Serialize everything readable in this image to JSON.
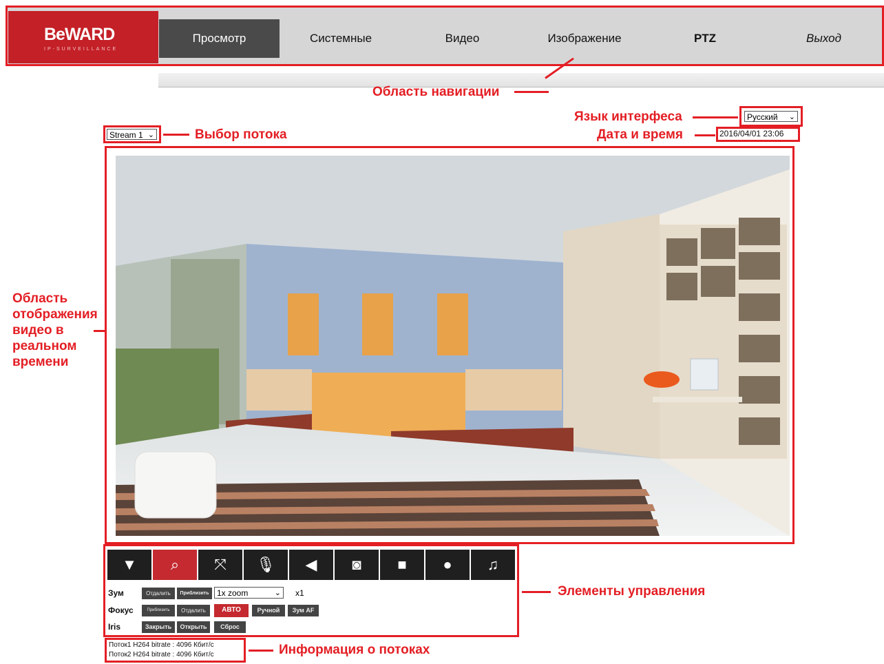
{
  "logo": {
    "brand": "BeWARD",
    "sub": "IP-SURVEILLANCE"
  },
  "nav": {
    "tabs": [
      {
        "label": "Просмотр"
      },
      {
        "label": "Системные"
      },
      {
        "label": "Видео"
      },
      {
        "label": "Изображение"
      },
      {
        "label": "PTZ"
      },
      {
        "label": "Выход"
      }
    ]
  },
  "annotations": {
    "nav_area": "Область навигации",
    "language": "Язык интерфеса",
    "datetime": "Дата и время",
    "stream_select": "Выбор потока",
    "video_area": [
      "Область",
      "отображения",
      "видео в",
      "реальном",
      "времени"
    ],
    "controls": "Элементы управления",
    "stream_info": "Информация о потоках"
  },
  "language_select": {
    "value": "Русский"
  },
  "datetime": "2016/04/01 23:06",
  "stream_select": {
    "value": "Stream 1"
  },
  "toolbar": {
    "icons": [
      "triangle-down-icon",
      "zoom-search-icon",
      "fullscreen-icon",
      "microphone-icon",
      "speaker-icon",
      "camera-snapshot-icon",
      "stop-icon",
      "record-icon",
      "alarm-bell-icon"
    ]
  },
  "controls": {
    "zoom": {
      "label": "Зум",
      "out": "Отдалить",
      "in": "Приблизить",
      "select": "1x zoom",
      "factor": "x1"
    },
    "focus": {
      "label": "Фокус",
      "near": "Приблизить",
      "far": "Отдалить",
      "auto": "АВТО",
      "manual": "Ручной",
      "af": "Зум AF"
    },
    "iris": {
      "label": "Iris",
      "close": "Закрыть",
      "open": "Открыть",
      "reset": "Сброс"
    }
  },
  "stream_info": [
    "Поток1 H264 bitrate : 4096 Кбит/с",
    "Поток2 H264 bitrate : 4096 Кбит/с"
  ],
  "colors": {
    "accent": "#e31e24",
    "brand": "#c42027",
    "nav_bg": "#d6d6d6",
    "nav_active": "#4a4a4a"
  }
}
